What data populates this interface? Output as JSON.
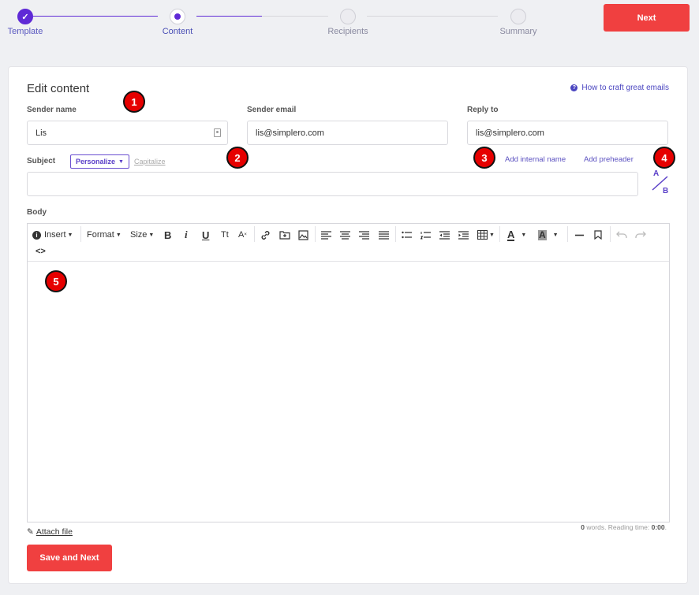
{
  "stepper": {
    "steps": [
      {
        "label": "Template",
        "state": "done"
      },
      {
        "label": "Content",
        "state": "active"
      },
      {
        "label": "Recipients",
        "state": "pending"
      },
      {
        "label": "Summary",
        "state": "pending"
      }
    ]
  },
  "header": {
    "next_label": "Next"
  },
  "page": {
    "title": "Edit content",
    "help_link": "How to craft great emails"
  },
  "form": {
    "sender_name": {
      "label": "Sender name",
      "value": "Lis"
    },
    "sender_email": {
      "label": "Sender email",
      "value": "lis@simplero.com"
    },
    "reply_to": {
      "label": "Reply to",
      "value": "lis@simplero.com"
    },
    "subject": {
      "label": "Subject",
      "personalize": "Personalize",
      "capitalize": "Capitalize",
      "value": ""
    },
    "add_internal_name": "Add internal name",
    "add_preheader": "Add preheader",
    "ab_top": "A",
    "ab_bottom": "B",
    "body_label": "Body"
  },
  "toolbar": {
    "insert": "Insert",
    "format": "Format",
    "size": "Size",
    "bold": "B",
    "italic": "i",
    "underline": "U",
    "tt": "Tt",
    "clear_format": "A"
  },
  "footer": {
    "attach": "Attach file",
    "word_count": "0",
    "words_text": " words. Reading time: ",
    "reading_time": "0:00",
    "period": ".",
    "save_next": "Save and Next"
  },
  "markers": [
    "1",
    "2",
    "3",
    "4",
    "5"
  ],
  "colors": {
    "primary_red": "#f04040",
    "accent_purple": "#5f2ad6",
    "link_blue": "#4a45c0"
  }
}
